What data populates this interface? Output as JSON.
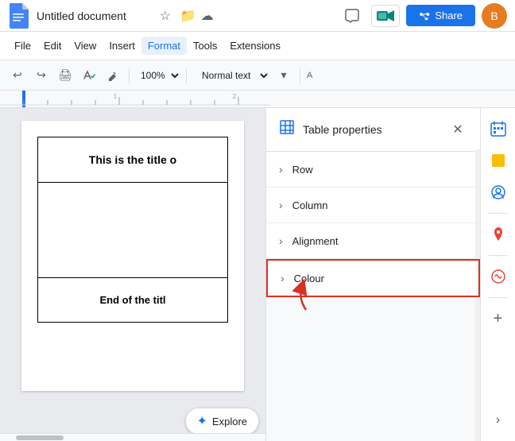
{
  "topbar": {
    "title": "Untitled document",
    "share_label": "Share",
    "avatar_letter": "B"
  },
  "menubar": {
    "items": [
      "File",
      "Edit",
      "View",
      "Insert",
      "Format",
      "Tools",
      "Extensions"
    ]
  },
  "toolbar": {
    "zoom": "100%",
    "style": "Normal text",
    "undo_label": "↩",
    "redo_label": "↪"
  },
  "document": {
    "title_text": "This is the title o",
    "end_text": "End of the titl"
  },
  "explore_btn": {
    "label": "Explore"
  },
  "table_properties": {
    "title": "Table properties",
    "items": [
      {
        "label": "Row"
      },
      {
        "label": "Column"
      },
      {
        "label": "Alignment"
      },
      {
        "label": "Colour"
      }
    ]
  },
  "icons": {
    "chevron_right": "›",
    "close": "✕",
    "table": "⊞",
    "explore_star": "✦"
  }
}
